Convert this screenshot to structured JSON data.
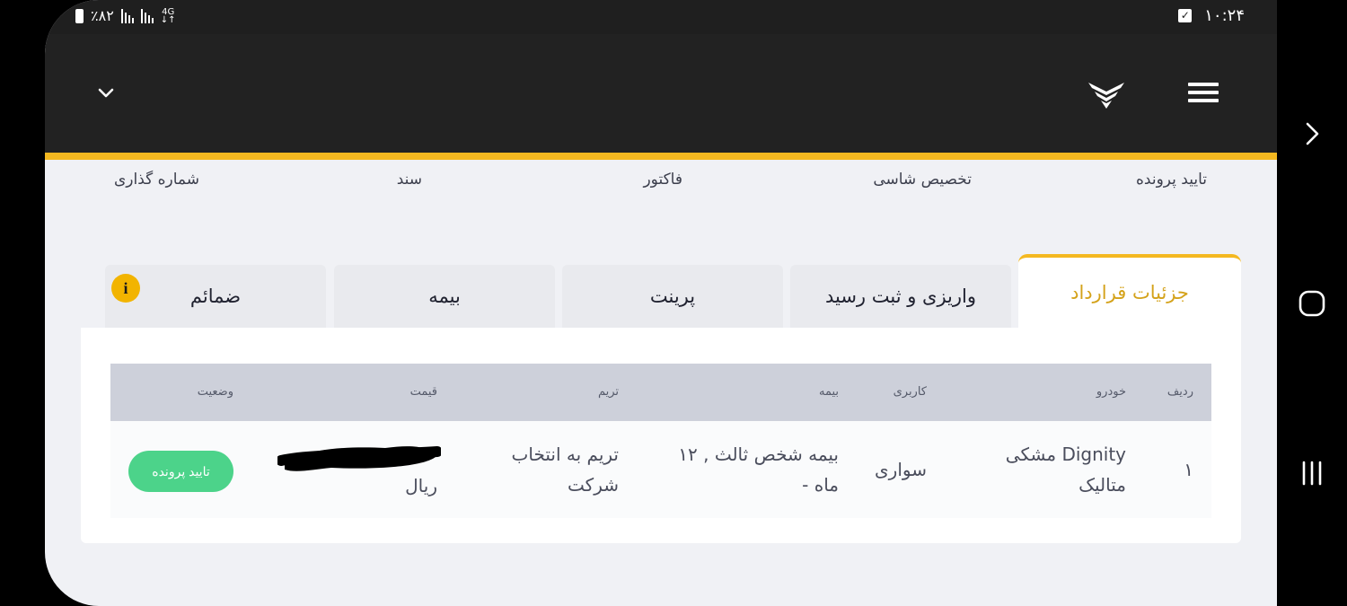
{
  "status_bar": {
    "battery": "٪۸۲",
    "network": "4G",
    "time": "۱۰:۲۴"
  },
  "app_bar": {
    "menu_icon": "hamburger-icon",
    "logo_icon": "brand-logo-icon",
    "dropdown_icon": "chevron-down-icon"
  },
  "steps": [
    "تایید پرونده",
    "تخصیص شاسی",
    "فاکتور",
    "سند",
    "شماره گذاری"
  ],
  "tabs": [
    "جزئیات قرارداد",
    "واریزی و ثبت رسید",
    "پرینت",
    "بیمه",
    "ضمائم"
  ],
  "info_badge": "i",
  "table": {
    "headers": {
      "row": "ردیف",
      "car": "خودرو",
      "usage": "کاربری",
      "insurance": "بیمه",
      "trim": "تریم",
      "price": "قیمت",
      "status": "وضعیت"
    },
    "row": {
      "row": "۱",
      "car": "Dignity مشکی متالیک",
      "usage": "سواری",
      "insurance": "بیمه شخص ثالث , ۱۲ ماه -",
      "trim": "تریم به انتخاب شرکت",
      "price": "ریال",
      "status": "تایید پرونده"
    }
  },
  "colors": {
    "accent": "#f4b820",
    "active_tab_text": "#d4a21a",
    "status_green": "#4cd38a",
    "app_bar": "#222222",
    "table_header": "#cdd0da"
  }
}
